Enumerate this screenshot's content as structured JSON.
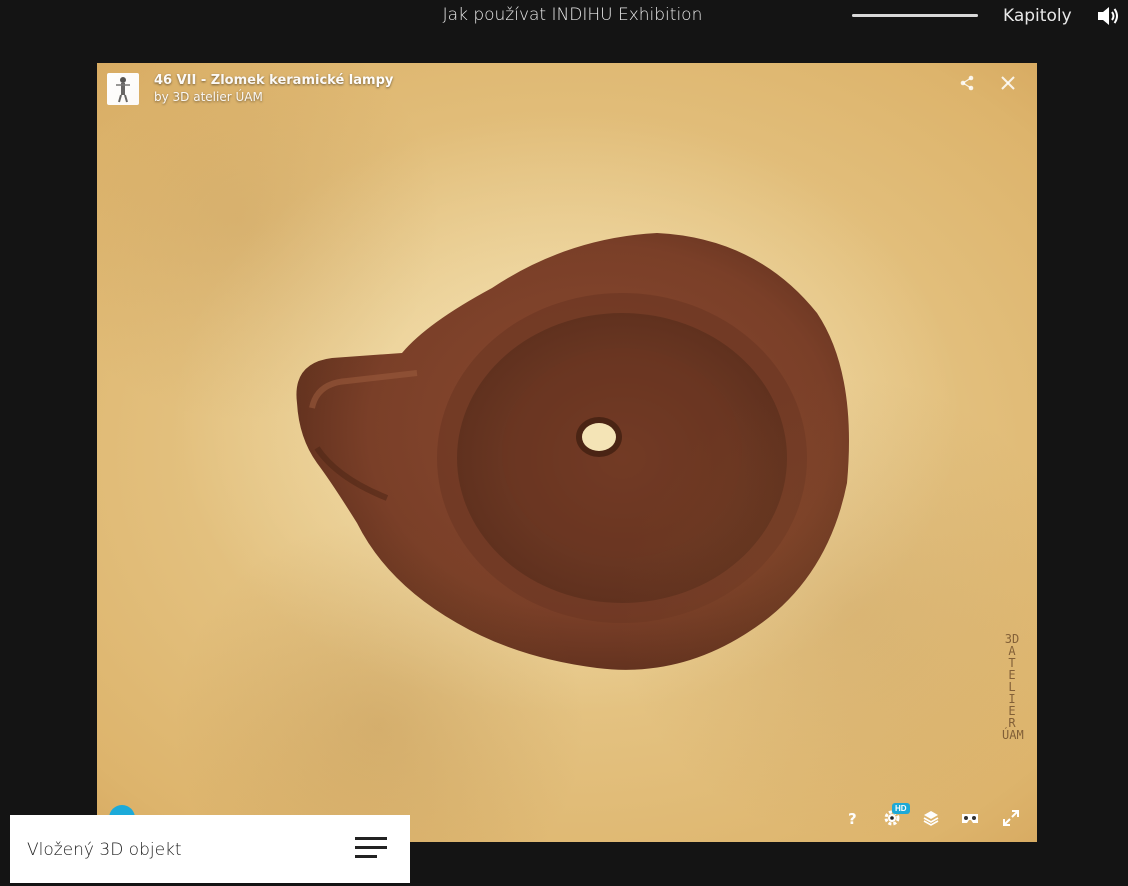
{
  "header": {
    "title": "Jak používat INDIHU Exhibition",
    "progress": 1.0,
    "chapters_label": "Kapitoly",
    "sound_icon": "speaker-icon"
  },
  "viewer": {
    "model_title": "46 VII - Zlomek keramické lampy",
    "by_prefix": "by",
    "author": "3D atelier ÚAM",
    "watermark_lines": [
      "3D",
      "A",
      "T",
      "E",
      "L",
      "I",
      "E",
      "R",
      "ÚAM"
    ],
    "hd_badge": "HD",
    "controls": [
      "help-icon",
      "settings-icon",
      "layers-icon",
      "vr-icon",
      "fullscreen-icon"
    ],
    "accent": "#1caad9"
  },
  "card": {
    "label": "Vložený 3D objekt",
    "menu_icon": "hamburger-menu-icon"
  }
}
